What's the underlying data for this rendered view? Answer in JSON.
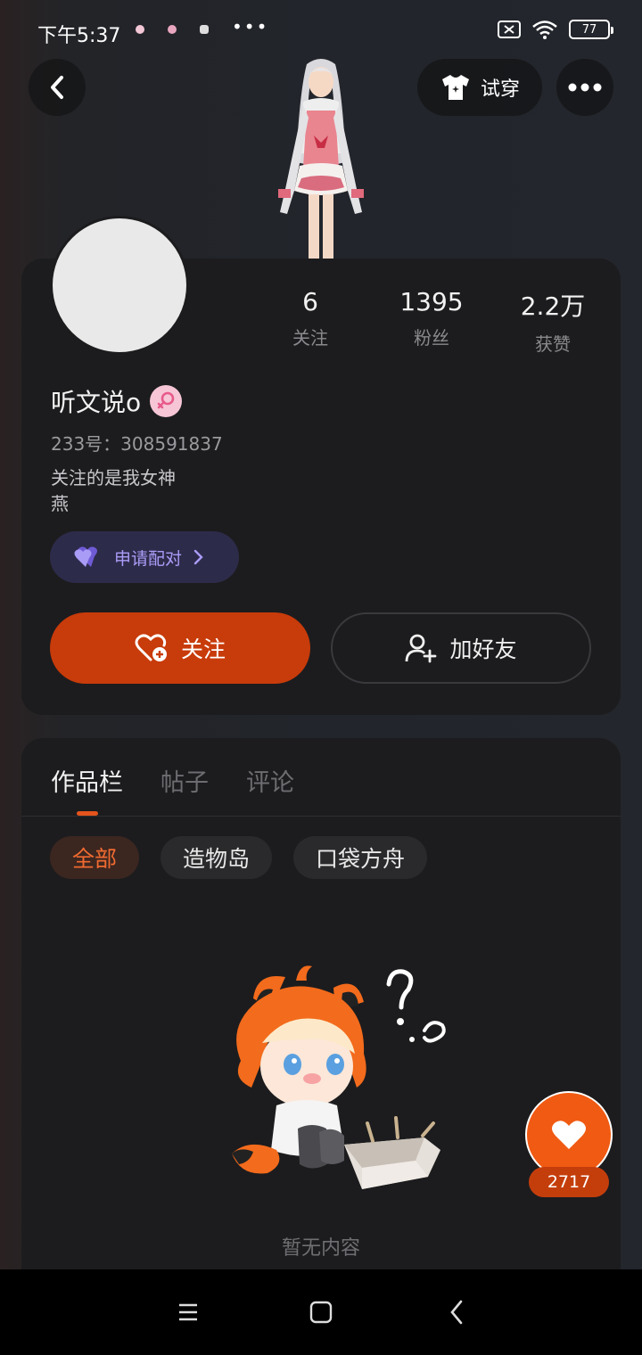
{
  "status_bar": {
    "time": "下午5:37",
    "more": "•••",
    "battery": "77"
  },
  "header": {
    "tryon_label": "试穿"
  },
  "profile": {
    "username": "听文说o",
    "gender_icon": "female-icon",
    "uid": "233号：308591837",
    "bio_line1": "关注的是我女神",
    "bio_line2": "燕",
    "pair_label": "申请配对",
    "stats": [
      {
        "value": "6",
        "label": "关注"
      },
      {
        "value": "1395",
        "label": "粉丝"
      },
      {
        "value": "2.2万",
        "label": "获赞"
      }
    ],
    "follow_label": "关注",
    "add_friend_label": "加好友"
  },
  "content": {
    "tabs": [
      "作品栏",
      "帖子",
      "评论"
    ],
    "active_tab": 0,
    "chips": [
      "全部",
      "造物岛",
      "口袋方舟"
    ],
    "active_chip": 0,
    "empty_text": "暂无内容"
  },
  "like_fab": {
    "count": "2717"
  },
  "colors": {
    "accent": "#c83b0a",
    "fab": "#f05a12",
    "pair": "#a99cf7"
  }
}
